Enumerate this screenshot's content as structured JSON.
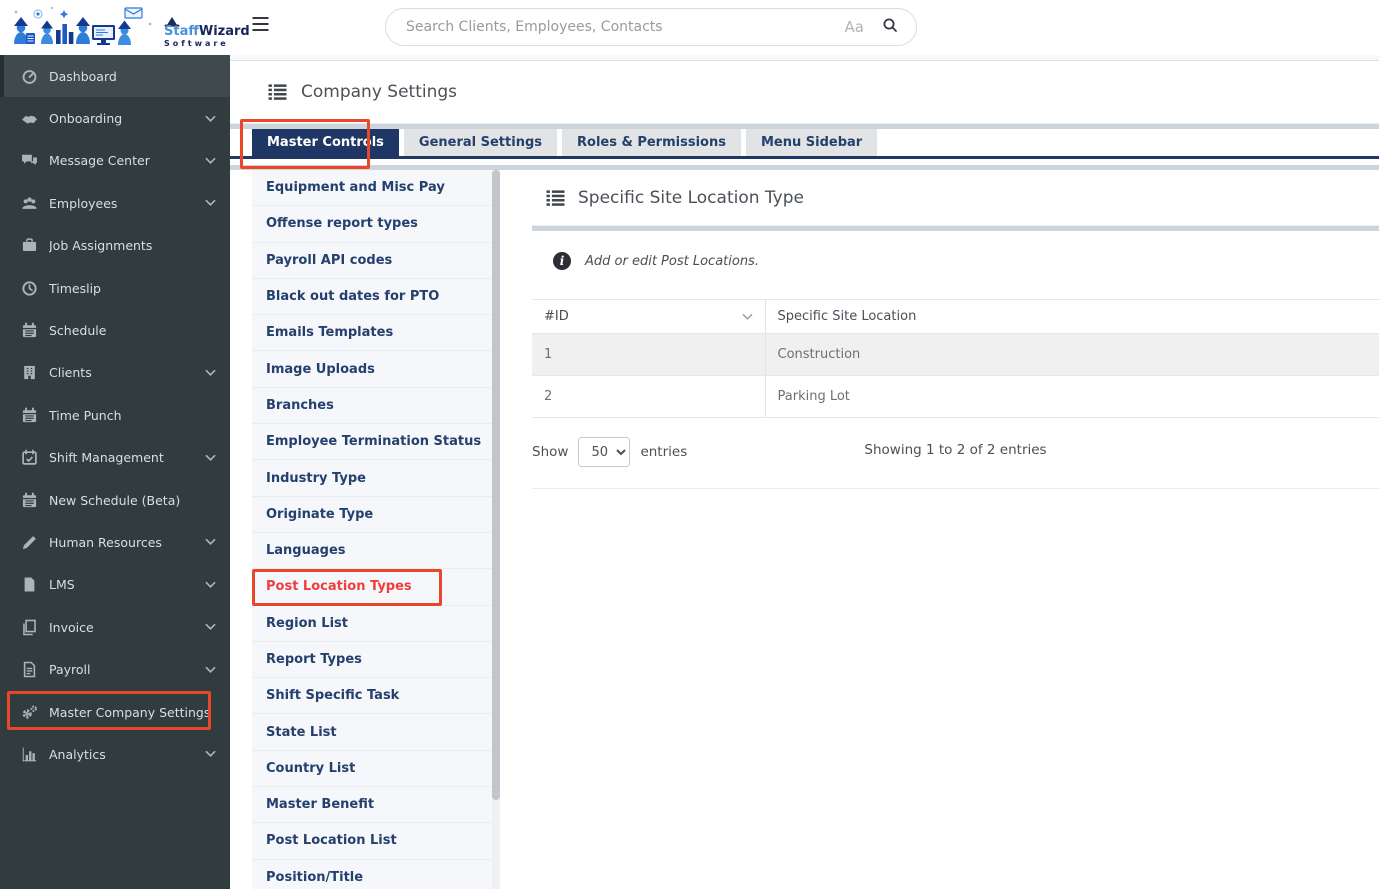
{
  "brand": {
    "name_part1": "Staff",
    "name_part2": "Wizard",
    "subtitle": "Software"
  },
  "topbar": {
    "search_placeholder": "Search Clients, Employees, Contacts",
    "case_label": "Aa"
  },
  "sidebar": {
    "items": [
      {
        "label": "Dashboard",
        "icon": "dashboard-icon",
        "active": true
      },
      {
        "label": "Onboarding",
        "icon": "handshake-icon",
        "chevron": true
      },
      {
        "label": "Message Center",
        "icon": "comments-icon",
        "chevron": true
      },
      {
        "label": "Employees",
        "icon": "users-icon",
        "chevron": true
      },
      {
        "label": "Job Assignments",
        "icon": "briefcase-icon"
      },
      {
        "label": "Timeslip",
        "icon": "clock-icon"
      },
      {
        "label": "Schedule",
        "icon": "calendar-icon"
      },
      {
        "label": "Clients",
        "icon": "building-icon",
        "chevron": true
      },
      {
        "label": "Time Punch",
        "icon": "calendar-icon"
      },
      {
        "label": "Shift Management",
        "icon": "calendar-check-icon",
        "chevron": true
      },
      {
        "label": "New Schedule (Beta)",
        "icon": "calendar-icon"
      },
      {
        "label": "Human Resources",
        "icon": "pencil-icon",
        "chevron": true
      },
      {
        "label": "LMS",
        "icon": "file-icon",
        "chevron": true
      },
      {
        "label": "Invoice",
        "icon": "copy-icon",
        "chevron": true
      },
      {
        "label": "Payroll",
        "icon": "file-text-icon",
        "chevron": true
      },
      {
        "label": "Master Company Settings",
        "icon": "gears-icon",
        "highlighted": true
      },
      {
        "label": "Analytics",
        "icon": "bar-chart-icon",
        "chevron": true
      }
    ]
  },
  "page": {
    "title": "Company Settings"
  },
  "tabs": [
    {
      "label": "Master Controls",
      "active": true,
      "highlighted": true
    },
    {
      "label": "General Settings"
    },
    {
      "label": "Roles & Permissions"
    },
    {
      "label": "Menu Sidebar"
    }
  ],
  "settings_list": [
    "Equipment and Misc Pay",
    "Offense report types",
    "Payroll API codes",
    "Black out dates for PTO",
    "Emails Templates",
    "Image Uploads",
    "Branches",
    "Employee Termination Status",
    "Industry Type",
    "Originate Type",
    "Languages",
    "Post Location Types",
    "Region List",
    "Report Types",
    "Shift Specific Task",
    "State List",
    "Country List",
    "Master Benefit",
    "Post Location List",
    "Position/Title"
  ],
  "panel": {
    "title": "Specific Site Location Type",
    "info_text": "Add or edit Post Locations.",
    "table": {
      "columns": [
        "#ID",
        "Specific Site Location"
      ],
      "rows": [
        {
          "id": "1",
          "location": "Construction"
        },
        {
          "id": "2",
          "location": "Parking Lot"
        }
      ]
    },
    "footer": {
      "show_label": "Show",
      "page_size": "50",
      "entries_label": "entries",
      "summary": "Showing 1 to 2 of 2 entries"
    }
  },
  "colors": {
    "accent_navy": "#1e3765",
    "highlight_red": "#e8472b",
    "sidebar_bg": "#313c3f",
    "active_item_red_text": "#f03e3e"
  }
}
